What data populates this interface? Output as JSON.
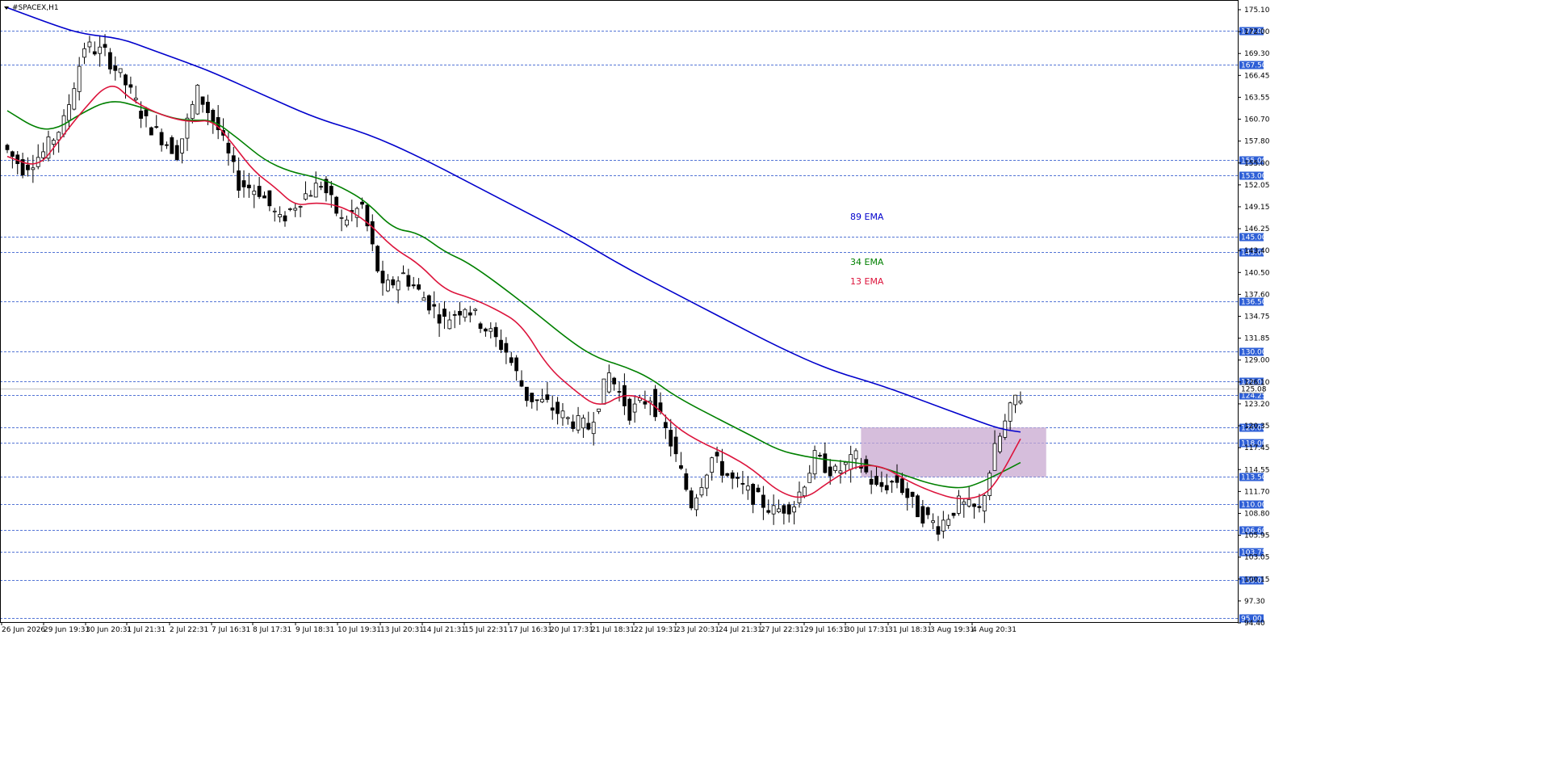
{
  "window": {
    "symbol_title": "#SPACEX,H1"
  },
  "chart_data": {
    "type": "candlestick",
    "y_range": [
      94.5,
      176.0
    ],
    "y_ticks": [
      "175.10",
      "172.00",
      "169.30",
      "166.45",
      "163.55",
      "160.70",
      "157.80",
      "155.00",
      "152.05",
      "149.15",
      "146.25",
      "143.40",
      "140.50",
      "137.60",
      "134.75",
      "131.85",
      "129.00",
      "126.10",
      "123.20",
      "120.35",
      "117.45",
      "114.55",
      "111.70",
      "108.80",
      "105.95",
      "103.05",
      "100.15",
      "97.30",
      "94.40"
    ],
    "level_lines": [
      {
        "value": 172.0,
        "label": "172.00"
      },
      {
        "value": 167.5,
        "label": "167.50"
      },
      {
        "value": 155.0,
        "label": "155.00"
      },
      {
        "value": 153.0,
        "label": "153.00"
      },
      {
        "value": 145.0,
        "label": "145.00"
      },
      {
        "value": 143.0,
        "label": "143.00"
      },
      {
        "value": 136.5,
        "label": "136.50"
      },
      {
        "value": 130.0,
        "label": "130.00"
      },
      {
        "value": 126.0,
        "label": "126.00"
      },
      {
        "value": 124.25,
        "label": "124.25"
      },
      {
        "value": 120.0,
        "label": "120.00"
      },
      {
        "value": 118.0,
        "label": "118.00"
      },
      {
        "value": 113.5,
        "label": "113.50"
      },
      {
        "value": 110.0,
        "label": "110.00"
      },
      {
        "value": 106.6,
        "label": "106.60"
      },
      {
        "value": 103.75,
        "label": "103.75"
      },
      {
        "value": 100.0,
        "label": "100.00"
      },
      {
        "value": 95.0,
        "label": "95.00"
      }
    ],
    "current_price": {
      "value": 125.08,
      "label": "125.08"
    },
    "x_labels": [
      "26 Jun 2026",
      "29 Jun 19:31",
      "30 Jun 20:31",
      "1 Jul 21:31",
      "2 Jul 22:31",
      "7 Jul 16:31",
      "8 Jul 17:31",
      "9 Jul 18:31",
      "10 Jul 19:31",
      "13 Jul 20:31",
      "14 Jul 21:31",
      "15 Jul 22:31",
      "17 Jul 16:31",
      "20 Jul 17:31",
      "21 Jul 18:31",
      "22 Jul 19:31",
      "23 Jul 20:31",
      "24 Jul 21:31",
      "27 Jul 22:31",
      "29 Jul 16:31",
      "30 Jul 17:31",
      "31 Jul 18:31",
      "3 Aug 19:31",
      "4 Aug 20:31"
    ],
    "bar_count": 240,
    "series": [
      {
        "name": "89 EMA",
        "color": "#0000cc",
        "points": [
          [
            0,
            175.0
          ],
          [
            10,
            172.5
          ],
          [
            15,
            171.5
          ],
          [
            22,
            171.0
          ],
          [
            28,
            169.5
          ],
          [
            35,
            167.8
          ],
          [
            40,
            166.5
          ],
          [
            50,
            163.5
          ],
          [
            60,
            160.5
          ],
          [
            70,
            158.5
          ],
          [
            80,
            155.5
          ],
          [
            90,
            152.0
          ],
          [
            100,
            148.5
          ],
          [
            110,
            145.0
          ],
          [
            120,
            141.0
          ],
          [
            130,
            137.5
          ],
          [
            140,
            134.0
          ],
          [
            150,
            130.5
          ],
          [
            160,
            127.5
          ],
          [
            170,
            125.5
          ],
          [
            180,
            123.0
          ],
          [
            188,
            121.0
          ],
          [
            193,
            119.8
          ],
          [
            197,
            119.4
          ]
        ]
      },
      {
        "name": "34 EMA",
        "color": "#008000",
        "points": [
          [
            0,
            161.5
          ],
          [
            6,
            159.0
          ],
          [
            10,
            159.2
          ],
          [
            14,
            161.0
          ],
          [
            20,
            163.0
          ],
          [
            26,
            162.0
          ],
          [
            32,
            160.5
          ],
          [
            36,
            160.2
          ],
          [
            40,
            160.3
          ],
          [
            45,
            157.8
          ],
          [
            50,
            155.0
          ],
          [
            55,
            153.5
          ],
          [
            60,
            152.8
          ],
          [
            65,
            151.5
          ],
          [
            70,
            149.5
          ],
          [
            75,
            146.0
          ],
          [
            80,
            145.5
          ],
          [
            85,
            143.0
          ],
          [
            90,
            141.5
          ],
          [
            100,
            136.5
          ],
          [
            110,
            131.0
          ],
          [
            115,
            129.0
          ],
          [
            120,
            128.0
          ],
          [
            125,
            126.5
          ],
          [
            130,
            124.0
          ],
          [
            140,
            120.5
          ],
          [
            145,
            118.8
          ],
          [
            150,
            117.0
          ],
          [
            155,
            116.2
          ],
          [
            160,
            115.7
          ],
          [
            165,
            115.4
          ],
          [
            170,
            114.8
          ],
          [
            175,
            113.6
          ],
          [
            180,
            112.5
          ],
          [
            185,
            112.0
          ],
          [
            188,
            112.4
          ],
          [
            193,
            114.0
          ],
          [
            197,
            115.4
          ]
        ]
      },
      {
        "name": "13 EMA",
        "color": "#dc143c",
        "points": [
          [
            0,
            155.5
          ],
          [
            6,
            154.0
          ],
          [
            10,
            157.5
          ],
          [
            14,
            161.0
          ],
          [
            20,
            165.5
          ],
          [
            24,
            163.0
          ],
          [
            28,
            161.5
          ],
          [
            32,
            160.5
          ],
          [
            36,
            160.0
          ],
          [
            40,
            160.3
          ],
          [
            44,
            157.0
          ],
          [
            48,
            153.5
          ],
          [
            52,
            151.5
          ],
          [
            56,
            149.0
          ],
          [
            60,
            149.5
          ],
          [
            65,
            149.0
          ],
          [
            70,
            147.0
          ],
          [
            75,
            143.5
          ],
          [
            80,
            141.5
          ],
          [
            85,
            138.0
          ],
          [
            90,
            137.0
          ],
          [
            95,
            135.5
          ],
          [
            100,
            133.5
          ],
          [
            105,
            128.0
          ],
          [
            110,
            125.0
          ],
          [
            115,
            122.5
          ],
          [
            120,
            124.5
          ],
          [
            125,
            123.5
          ],
          [
            130,
            120.0
          ],
          [
            135,
            118.0
          ],
          [
            140,
            116.5
          ],
          [
            145,
            114.5
          ],
          [
            150,
            111.5
          ],
          [
            155,
            110.5
          ],
          [
            160,
            113.0
          ],
          [
            165,
            115.0
          ],
          [
            170,
            115.0
          ],
          [
            175,
            113.0
          ],
          [
            180,
            111.5
          ],
          [
            185,
            110.5
          ],
          [
            190,
            111.0
          ],
          [
            193,
            113.5
          ],
          [
            197,
            118.5
          ]
        ]
      }
    ],
    "ema_labels": [
      {
        "text": "89 EMA",
        "color": "#0000cc"
      },
      {
        "text": "34 EMA",
        "color": "#008000"
      },
      {
        "text": "13 EMA",
        "color": "#dc143c"
      }
    ],
    "zone": {
      "x_bars": [
        166,
        202
      ],
      "y_range": [
        113.5,
        120.0
      ],
      "color": "#c8a8d0"
    },
    "anchors": [
      [
        0,
        157
      ],
      [
        4,
        154
      ],
      [
        8,
        156
      ],
      [
        12,
        160
      ],
      [
        16,
        170
      ],
      [
        20,
        169
      ],
      [
        24,
        165
      ],
      [
        28,
        160
      ],
      [
        34,
        156
      ],
      [
        38,
        164
      ],
      [
        42,
        159
      ],
      [
        46,
        152
      ],
      [
        50,
        151
      ],
      [
        54,
        147
      ],
      [
        58,
        150
      ],
      [
        62,
        152
      ],
      [
        66,
        147
      ],
      [
        70,
        149
      ],
      [
        74,
        138
      ],
      [
        78,
        140
      ],
      [
        82,
        137
      ],
      [
        86,
        134
      ],
      [
        90,
        136
      ],
      [
        94,
        133
      ],
      [
        98,
        130
      ],
      [
        102,
        124
      ],
      [
        106,
        123
      ],
      [
        110,
        121
      ],
      [
        114,
        120
      ],
      [
        118,
        127
      ],
      [
        122,
        122
      ],
      [
        126,
        124
      ],
      [
        130,
        118
      ],
      [
        134,
        110
      ],
      [
        138,
        116
      ],
      [
        142,
        113
      ],
      [
        146,
        111
      ],
      [
        150,
        109
      ],
      [
        154,
        110
      ],
      [
        158,
        116
      ],
      [
        162,
        114
      ],
      [
        166,
        116
      ],
      [
        170,
        112
      ],
      [
        174,
        113
      ],
      [
        178,
        109
      ],
      [
        182,
        107
      ],
      [
        186,
        110
      ],
      [
        190,
        109
      ],
      [
        193,
        117
      ],
      [
        197,
        124
      ]
    ]
  }
}
